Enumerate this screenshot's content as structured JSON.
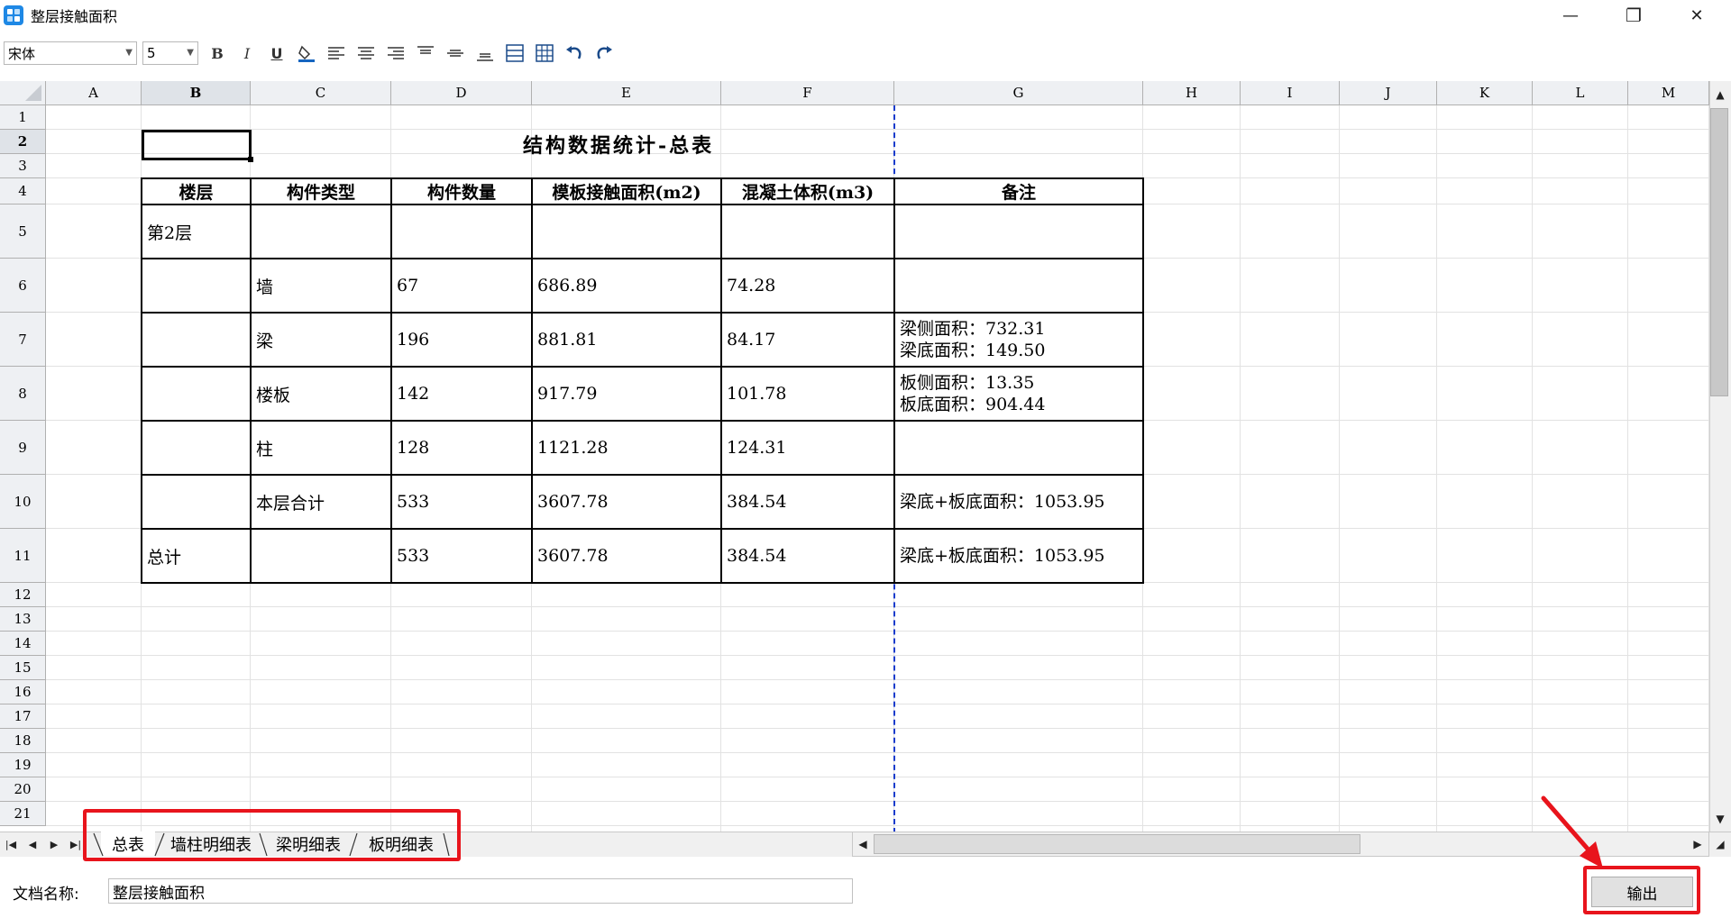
{
  "window": {
    "title": "整层接触面积",
    "minimize": "—",
    "restore": "❐",
    "close": "✕"
  },
  "toolbar": {
    "font_family": "宋体",
    "font_size": "5",
    "bold": "B",
    "italic": "I",
    "underline": "U"
  },
  "sheet": {
    "columns": [
      "A",
      "B",
      "C",
      "D",
      "E",
      "F",
      "G",
      "H",
      "I",
      "J",
      "K",
      "L",
      "M"
    ],
    "active_column": "B",
    "rows": [
      "1",
      "2",
      "3",
      "4",
      "5",
      "6",
      "7",
      "8",
      "9",
      "10",
      "11",
      "12",
      "13",
      "14",
      "15",
      "16",
      "17",
      "18",
      "19",
      "20",
      "21"
    ],
    "active_row": "2",
    "title": "结构数据统计-总表",
    "table": {
      "headers": [
        "楼层",
        "构件类型",
        "构件数量",
        "模板接触面积(m2)",
        "混凝土体积(m3)",
        "备注"
      ],
      "rows": [
        {
          "floor": "第2层",
          "type": "",
          "count": "",
          "area": "",
          "volume": "",
          "note": []
        },
        {
          "floor": "",
          "type": "墙",
          "count": "67",
          "area": "686.89",
          "volume": "74.28",
          "note": []
        },
        {
          "floor": "",
          "type": "梁",
          "count": "196",
          "area": "881.81",
          "volume": "84.17",
          "note": [
            "梁侧面积：732.31",
            "梁底面积：149.50"
          ]
        },
        {
          "floor": "",
          "type": "楼板",
          "count": "142",
          "area": "917.79",
          "volume": "101.78",
          "note": [
            "板侧面积：13.35",
            "板底面积：904.44"
          ]
        },
        {
          "floor": "",
          "type": "柱",
          "count": "128",
          "area": "1121.28",
          "volume": "124.31",
          "note": []
        },
        {
          "floor": "",
          "type": "本层合计",
          "count": "533",
          "area": "3607.78",
          "volume": "384.54",
          "note": [
            "梁底+板底面积：1053.95"
          ]
        },
        {
          "floor": "总计",
          "type": "",
          "count": "533",
          "area": "3607.78",
          "volume": "384.54",
          "note": [
            "梁底+板底面积：1053.95"
          ]
        }
      ]
    }
  },
  "tabs": [
    {
      "label": "总表",
      "active": true
    },
    {
      "label": "墙柱明细表",
      "active": false
    },
    {
      "label": "梁明细表",
      "active": false
    },
    {
      "label": "板明细表",
      "active": false
    }
  ],
  "bottom": {
    "doc_name_label": "文档名称:",
    "doc_name_value": "整层接触面积",
    "output_label": "输出"
  },
  "colors": {
    "highlight": "#e8141c",
    "page_break": "#1a3ccc",
    "header_bg": "#eef0f3"
  }
}
